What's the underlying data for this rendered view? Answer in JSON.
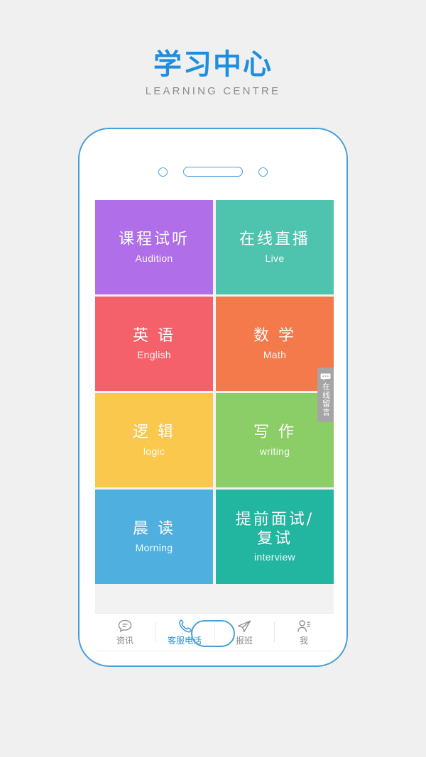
{
  "header": {
    "brand_cn": "学习中心",
    "brand_en": "LEARNING CENTRE",
    "brand_color": "#1e8fe0"
  },
  "phone": {
    "camera_icon": "camera-dot-icon",
    "speaker_icon": "speaker-slot-icon",
    "home_button": "home-button",
    "frame_color": "#4a9fd8"
  },
  "side_tab": {
    "icon": "message-bubble-icon",
    "label": "在线留言",
    "background": "#a5a5a5"
  },
  "tiles": [
    {
      "cn": "课程试听",
      "en": "Audition",
      "color": "#b06ee8",
      "name": "tile-audition"
    },
    {
      "cn": "在线直播",
      "en": "Live",
      "color": "#4ec4ae",
      "name": "tile-live"
    },
    {
      "cn": "英 语",
      "en": "English",
      "color": "#f4616b",
      "name": "tile-english"
    },
    {
      "cn": "数 学",
      "en": "Math",
      "color": "#f4794b",
      "name": "tile-math"
    },
    {
      "cn": "逻 辑",
      "en": "logic",
      "color": "#f9c84d",
      "name": "tile-logic"
    },
    {
      "cn": "写 作",
      "en": "writing",
      "color": "#8bcd66",
      "name": "tile-writing"
    },
    {
      "cn": "晨 读",
      "en": "Morning",
      "color": "#4fb0e0",
      "name": "tile-morning"
    },
    {
      "cn": "提前面试/\n复试",
      "en": "interview",
      "color": "#22b5a0",
      "name": "tile-interview"
    }
  ],
  "bottom_nav": {
    "active_color": "#2e90e0",
    "inactive_color": "#8a8a8a",
    "items": [
      {
        "label": "资讯",
        "icon": "chat-bubble-icon",
        "active": false
      },
      {
        "label": "客服电话",
        "icon": "phone-icon",
        "active": true
      },
      {
        "label": "报班",
        "icon": "paper-plane-icon",
        "active": false
      },
      {
        "label": "我",
        "icon": "person-icon",
        "active": false
      }
    ]
  }
}
